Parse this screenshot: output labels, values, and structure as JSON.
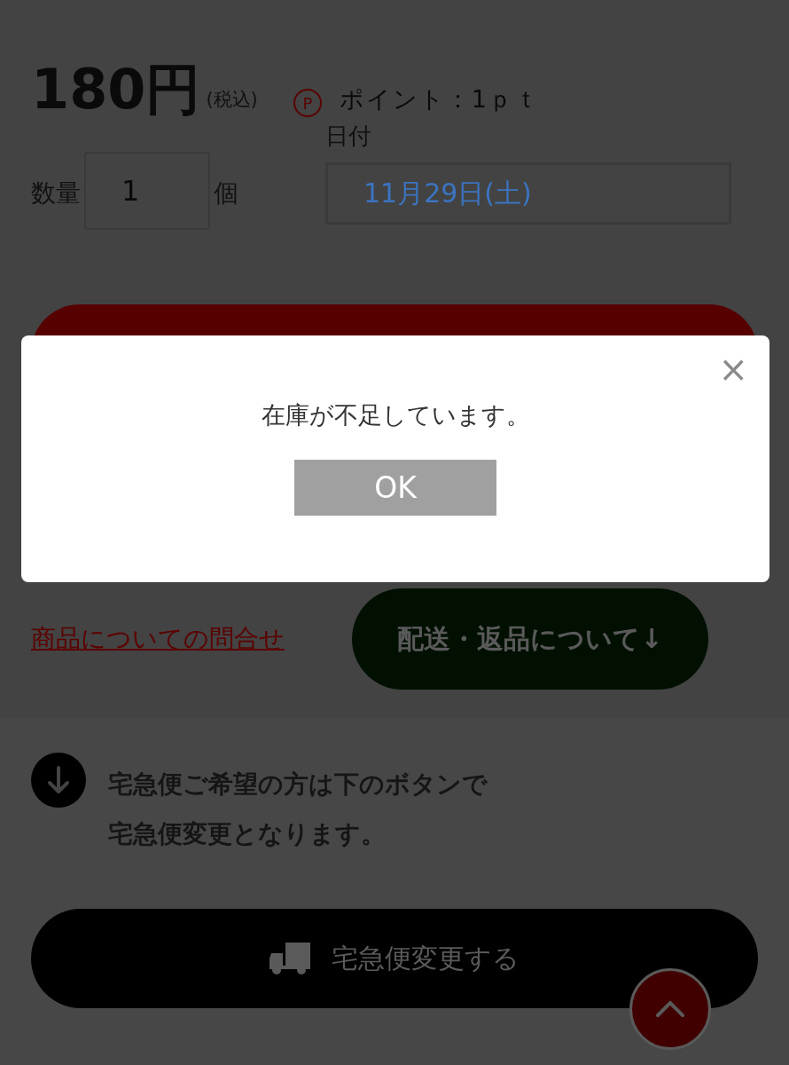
{
  "price": {
    "amount": "180円",
    "tax_note": "(税込)"
  },
  "points": {
    "icon": "P",
    "label": "ポイント：1ｐｔ"
  },
  "quantity": {
    "label": "数量",
    "value": "1",
    "unit": "個"
  },
  "date": {
    "label": "日付",
    "value": "11月29日(土)"
  },
  "inquiry_link": "商品についての問合せ",
  "shipping_button": "配送・返品について↓",
  "notice": {
    "lines": [
      "宅急便ご希望の方は下のボタンで",
      "宅急便変更となります。"
    ]
  },
  "delivery_button": "宅急便変更する",
  "dialog": {
    "message": "在庫が不足しています。",
    "ok": "OK",
    "close": "×"
  }
}
